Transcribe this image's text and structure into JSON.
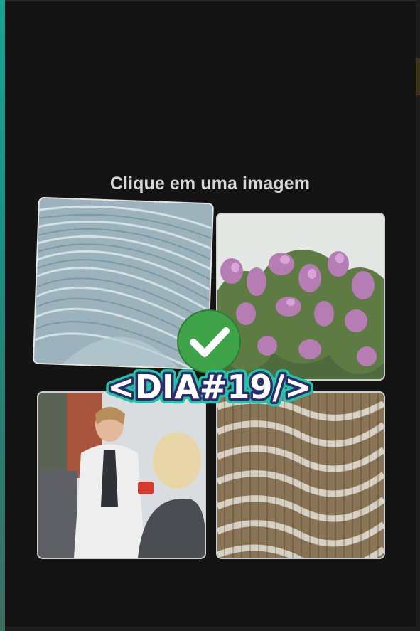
{
  "captcha": {
    "title": "Clique em uma imagem",
    "images": [
      {
        "icon": "abstract-curved-panels-image"
      },
      {
        "icon": "lilac-tree-image"
      },
      {
        "icon": "doctor-patient-image"
      },
      {
        "icon": "wavy-sculpture-image"
      }
    ]
  },
  "overlay": {
    "label": "<DIA#19/>",
    "check_icon": "checkmark-circle-icon",
    "colors": {
      "check_green": "#3fa34a",
      "label_fill": "#ffffff",
      "label_outline": "#2a2d6a",
      "label_glow": "#25c2a6"
    }
  }
}
